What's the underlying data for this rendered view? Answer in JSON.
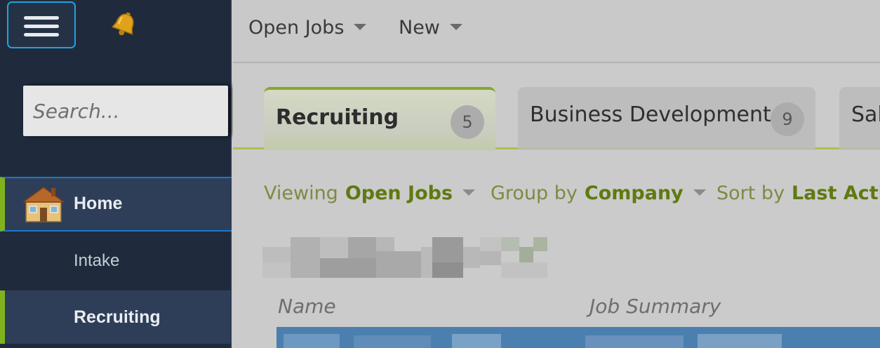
{
  "sidebar": {
    "search_placeholder": "Search...",
    "nav": [
      {
        "label": "Home",
        "icon": "house-icon"
      },
      {
        "label": "Intake"
      },
      {
        "label": "Recruiting"
      }
    ]
  },
  "topbar": {
    "open_jobs_label": "Open Jobs",
    "new_label": "New"
  },
  "tabs": [
    {
      "label": "Recruiting",
      "count": "5"
    },
    {
      "label": "Business Development",
      "count": "9"
    },
    {
      "label": "Sal"
    }
  ],
  "filters": {
    "viewing_label": "Viewing",
    "viewing_value": "Open Jobs",
    "group_label": "Group by",
    "group_value": "Company",
    "sort_label": "Sort by",
    "sort_value": "Last Activ"
  },
  "table": {
    "columns": [
      "Name",
      "Job Summary"
    ]
  },
  "colors": {
    "sidebar_bg": "#1f2b3c",
    "accent_green": "#7fb31e",
    "accent_blue": "#1fa3de"
  }
}
